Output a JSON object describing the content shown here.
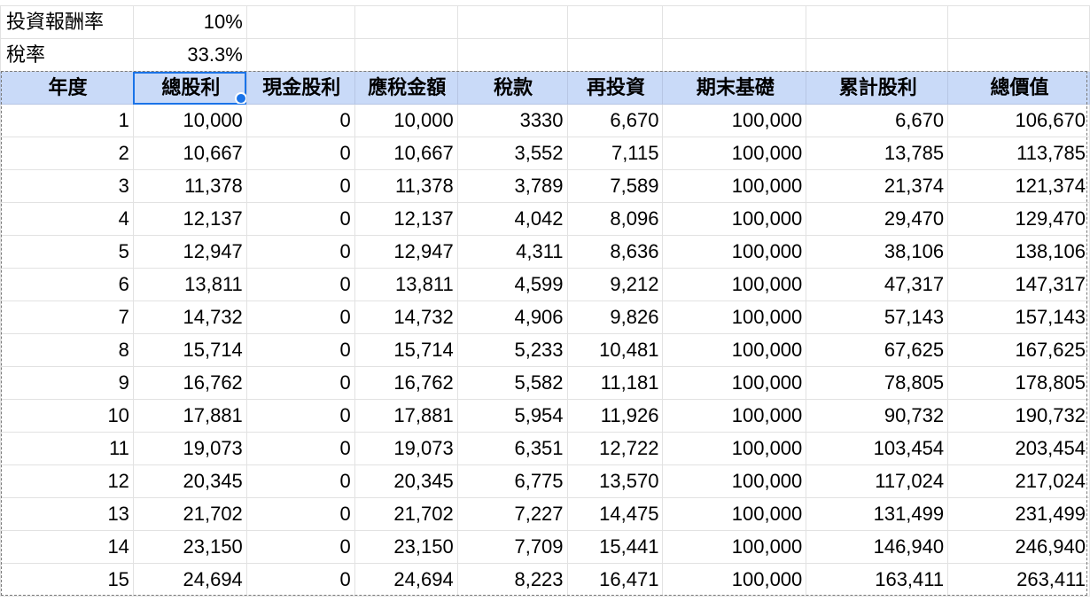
{
  "params": [
    {
      "label": "投資報酬率",
      "value": "10%"
    },
    {
      "label": "稅率",
      "value": "33.3%"
    }
  ],
  "headers": [
    "年度",
    "總股利",
    "現金股利",
    "應稅金額",
    "稅款",
    "再投資",
    "期末基礎",
    "累計股利",
    "總價值"
  ],
  "selection": {
    "header_index": 1
  },
  "rows": [
    [
      "1",
      "10,000",
      "0",
      "10,000",
      "3330",
      "6,670",
      "100,000",
      "6,670",
      "106,670"
    ],
    [
      "2",
      "10,667",
      "0",
      "10,667",
      "3,552",
      "7,115",
      "100,000",
      "13,785",
      "113,785"
    ],
    [
      "3",
      "11,378",
      "0",
      "11,378",
      "3,789",
      "7,589",
      "100,000",
      "21,374",
      "121,374"
    ],
    [
      "4",
      "12,137",
      "0",
      "12,137",
      "4,042",
      "8,096",
      "100,000",
      "29,470",
      "129,470"
    ],
    [
      "5",
      "12,947",
      "0",
      "12,947",
      "4,311",
      "8,636",
      "100,000",
      "38,106",
      "138,106"
    ],
    [
      "6",
      "13,811",
      "0",
      "13,811",
      "4,599",
      "9,212",
      "100,000",
      "47,317",
      "147,317"
    ],
    [
      "7",
      "14,732",
      "0",
      "14,732",
      "4,906",
      "9,826",
      "100,000",
      "57,143",
      "157,143"
    ],
    [
      "8",
      "15,714",
      "0",
      "15,714",
      "5,233",
      "10,481",
      "100,000",
      "67,625",
      "167,625"
    ],
    [
      "9",
      "16,762",
      "0",
      "16,762",
      "5,582",
      "11,181",
      "100,000",
      "78,805",
      "178,805"
    ],
    [
      "10",
      "17,881",
      "0",
      "17,881",
      "5,954",
      "11,926",
      "100,000",
      "90,732",
      "190,732"
    ],
    [
      "11",
      "19,073",
      "0",
      "19,073",
      "6,351",
      "12,722",
      "100,000",
      "103,454",
      "203,454"
    ],
    [
      "12",
      "20,345",
      "0",
      "20,345",
      "6,775",
      "13,570",
      "100,000",
      "117,024",
      "217,024"
    ],
    [
      "13",
      "21,702",
      "0",
      "21,702",
      "7,227",
      "14,475",
      "100,000",
      "131,499",
      "231,499"
    ],
    [
      "14",
      "23,150",
      "0",
      "23,150",
      "7,709",
      "15,441",
      "100,000",
      "146,940",
      "246,940"
    ],
    [
      "15",
      "24,694",
      "0",
      "24,694",
      "8,223",
      "16,471",
      "100,000",
      "163,411",
      "263,411"
    ]
  ],
  "colors": {
    "header_fill": "#c9daf8",
    "selection_border": "#1a73e8",
    "gridline": "#e2e2e2"
  }
}
